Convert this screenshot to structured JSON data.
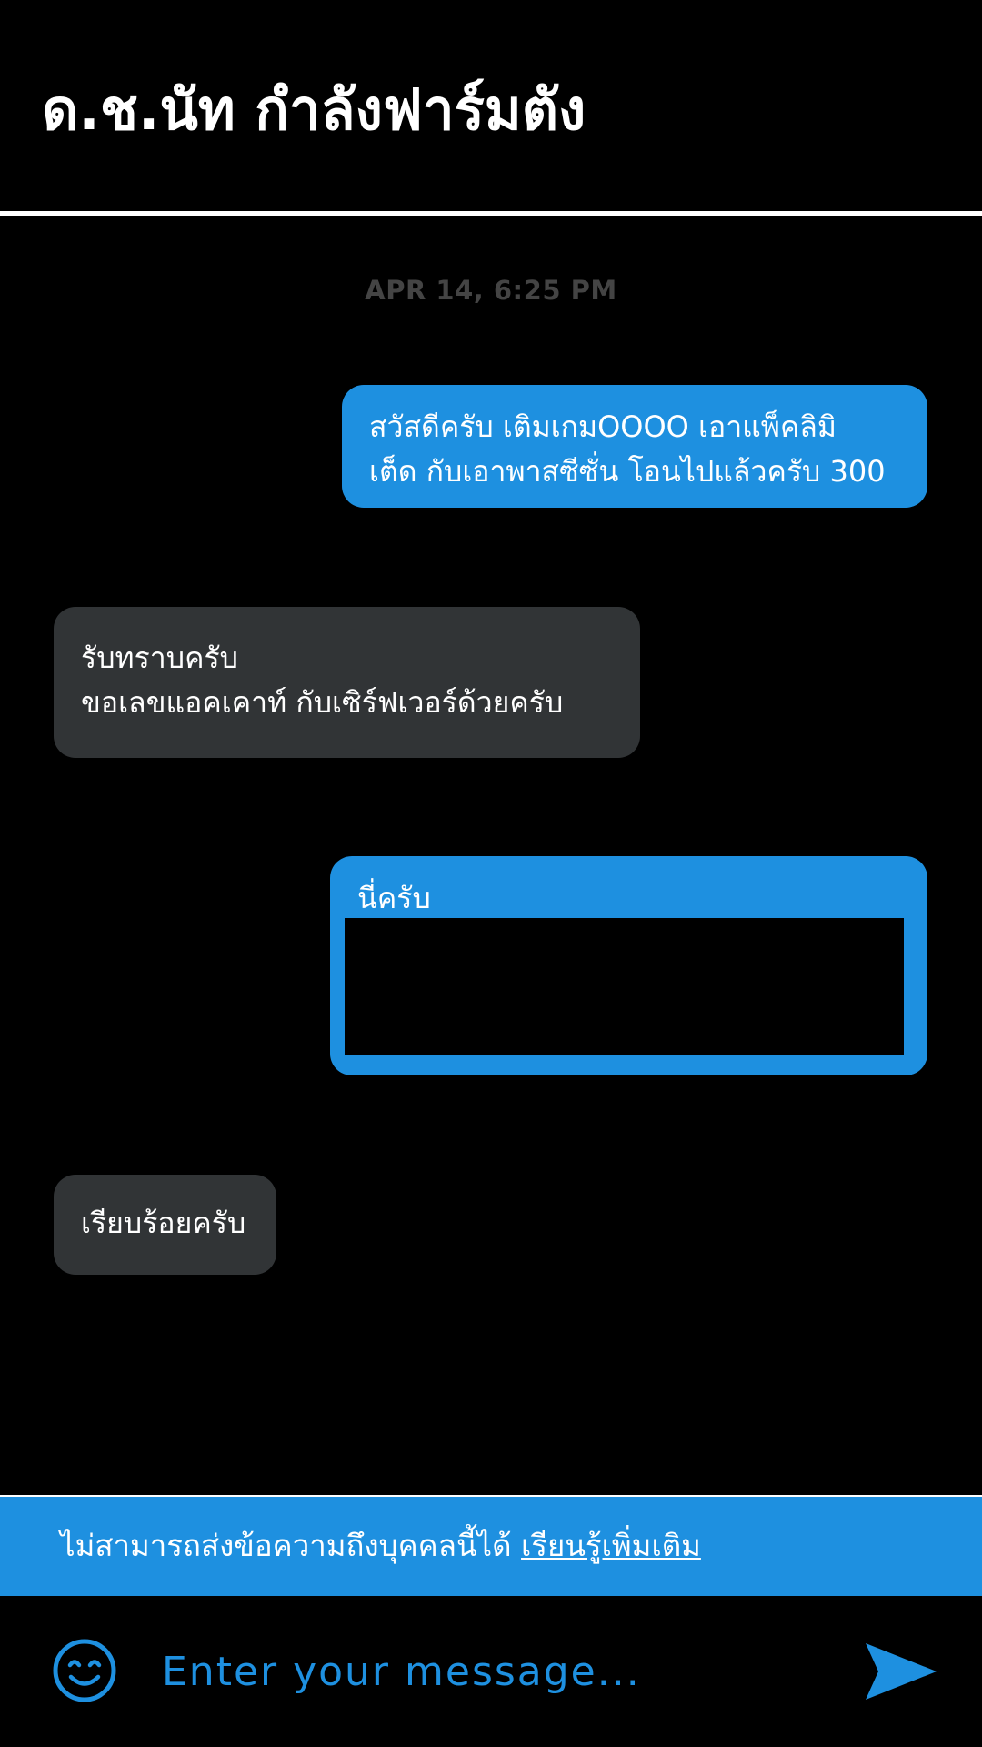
{
  "header": {
    "title": "ด.ช.นัท กำลังฟาร์มตัง"
  },
  "timestamp": "APR 14, 6:25 PM",
  "messages": [
    {
      "direction": "outgoing",
      "lines": [
        "สวัสดีครับ เติมเกมOOOO เอาแพ็คลิมิ",
        "เต็ด กับเอาพาสซีซั่น โอนไปแล้วครับ 300"
      ]
    },
    {
      "direction": "incoming",
      "lines": [
        "รับทราบครับ",
        "ขอเลขแอคเคาท์ กับเซิร์ฟเวอร์ด้วยครับ"
      ]
    },
    {
      "direction": "outgoing",
      "lines": [
        "นี่ครับ"
      ],
      "attachment": "image"
    },
    {
      "direction": "incoming",
      "lines": [
        "เรียบร้อยครับ"
      ]
    }
  ],
  "banner": {
    "text": "ไม่สามารถส่งข้อความถึงบุคคลนี้ได้",
    "link": "เรียนรู้เพิ่มเติม"
  },
  "composer": {
    "placeholder": "Enter your message...",
    "emoji_icon": "smiley-face-icon",
    "send_icon": "send-arrow-icon"
  },
  "colors": {
    "background": "#000000",
    "accent": "#1e90e0",
    "incoming_bubble": "#313436",
    "timestamp": "#444444",
    "text": "#ffffff"
  }
}
